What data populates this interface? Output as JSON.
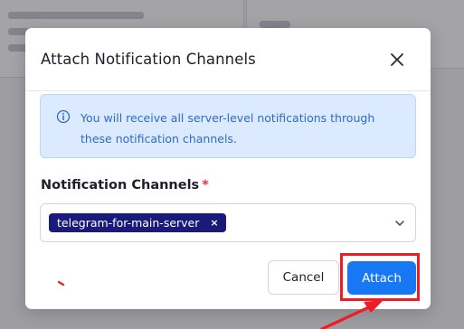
{
  "dialog": {
    "title": "Attach Notification Channels",
    "info_message": "You will receive all server-level notifications through these notification channels.",
    "field_label": "Notification Channels",
    "required_marker": "*",
    "selected_channels": [
      {
        "label": "telegram-for-main-server",
        "remove_glyph": "×"
      }
    ],
    "cancel_label": "Cancel",
    "attach_label": "Attach"
  },
  "icons": {
    "close": "close-icon",
    "info": "info-icon",
    "chevron": "chevron-down-icon"
  },
  "colors": {
    "primary": "#1877f2",
    "chip_bg": "#1a1a7a",
    "info_bg": "#dbeafe",
    "info_text": "#2e6bc9",
    "required": "#e0324b",
    "annotation": "#ee1c24"
  }
}
